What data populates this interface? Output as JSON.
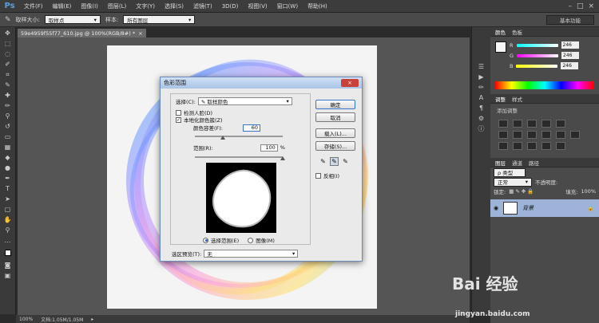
{
  "app": {
    "logo": "Ps"
  },
  "menu": [
    "文件(F)",
    "编辑(E)",
    "图像(I)",
    "图层(L)",
    "文字(Y)",
    "选择(S)",
    "滤镜(T)",
    "3D(D)",
    "视图(V)",
    "窗口(W)",
    "帮助(H)"
  ],
  "window_buttons": [
    "–",
    "□",
    "×"
  ],
  "options": {
    "sample_size_label": "取样大小:",
    "sample_size_value": "取样点",
    "sample_label": "样本:",
    "sample_value": "所有图层",
    "workspace": "基本功能"
  },
  "document": {
    "tab_title": "59e4959f55f77_610.jpg @ 100%(RGB/8#) *",
    "zoom": "100%",
    "doc_info": "文档:1.05M/1.05M"
  },
  "panels": {
    "color_tabs": [
      "颜色",
      "色板"
    ],
    "r_label": "R",
    "r_value": "246",
    "g_label": "G",
    "g_value": "246",
    "b_label": "B",
    "b_value": "246",
    "adjust_tabs": [
      "调整",
      "样式"
    ],
    "adjust_hint": "添加调整",
    "layers_tabs": [
      "图层",
      "通道",
      "路径"
    ],
    "kind_label": "ρ 类型",
    "blend_mode": "正常",
    "opacity_label": "不透明度:",
    "lock_label": "锁定:",
    "fill_label": "填充:",
    "fill_value": "100%",
    "layer_name": "背景"
  },
  "dialog": {
    "title": "色彩范围",
    "close": "×",
    "select_label": "选择(C):",
    "select_value": "取样颜色",
    "detect_faces": "检测人脸(D)",
    "localized": "本地化颜色簇(Z)",
    "fuzziness_label": "颜色容差(F):",
    "fuzziness_value": "60",
    "range_label": "范围(R):",
    "range_value": "100",
    "range_unit": "%",
    "selection_radio": "选择范围(E)",
    "image_radio": "图像(M)",
    "preview_label": "选区预览(T):",
    "preview_value": "无",
    "ok": "确定",
    "cancel": "取消",
    "load": "载入(L)...",
    "save": "存储(S)...",
    "invert": "反相(I)",
    "localized_checked": true,
    "detect_faces_checked": false
  },
  "watermark": {
    "text": "Bai 经验",
    "sub": "jingyan.baidu.com"
  },
  "colors": {
    "accent": "#3a74c8",
    "layer_highlight": "#9db4d8"
  }
}
